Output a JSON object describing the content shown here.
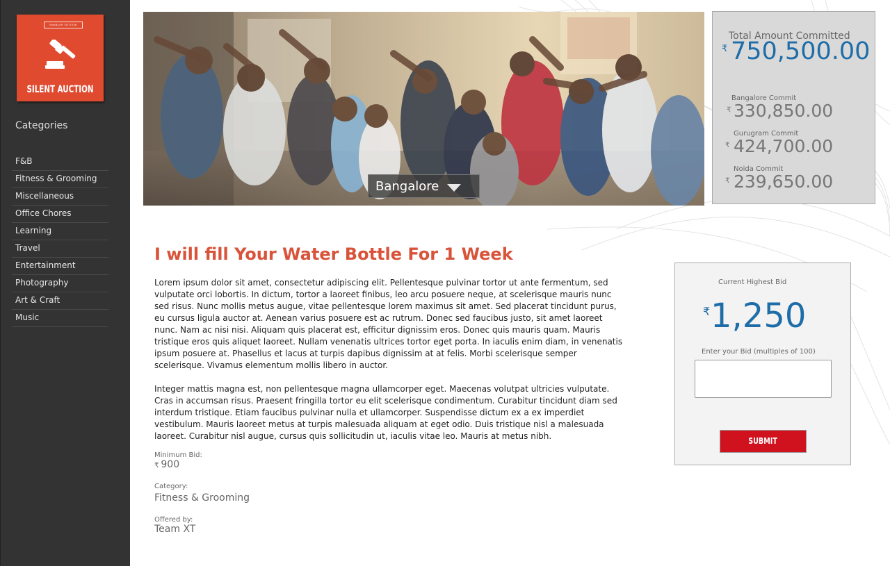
{
  "sidebar": {
    "logo": {
      "badge": "ENABLER EDITION",
      "title": "SILENT AUCTION"
    },
    "categories_title": "Categories",
    "categories": [
      "F&B",
      "Fitness & Grooming",
      "Miscellaneous",
      "Office Chores",
      "Learning",
      "Travel",
      "Entertainment",
      "Photography",
      "Art & Craft",
      "Music"
    ]
  },
  "hero": {
    "city": "Bangalore",
    "arrow_icon": "caret-down-icon"
  },
  "totals": {
    "label": "Total Amount Committed",
    "currency": "₹",
    "value": "750,500.00",
    "cities": [
      {
        "label": "Bangalore Commit",
        "value": "330,850.00"
      },
      {
        "label": "Gurugram Commit",
        "value": "424,700.00"
      },
      {
        "label": "Noida Commit",
        "value": "239,650.00"
      }
    ]
  },
  "item": {
    "title": "I will fill Your Water Bottle For 1 Week",
    "description": [
      "Lorem ipsum dolor sit amet, consectetur adipiscing elit. Pellentesque pulvinar tortor ut ante fermentum, sed vulputate orci lobortis. In dictum, tortor a laoreet finibus, leo arcu posuere neque, at scelerisque mauris nunc sed risus. Nunc mollis metus augue, vitae pellentesque lorem maximus sit amet. Sed placerat tincidunt purus, eu cursus ligula auctor at. Aenean varius posuere est ac rutrum. Donec sed faucibus justo, sit amet laoreet nunc. Nam ac nisi nisi. Aliquam quis placerat est, efficitur dignissim eros. Donec quis mauris quam. Mauris tristique eros quis aliquet laoreet. Nullam venenatis ultrices tortor eget porta. In iaculis enim diam, in venenatis ipsum posuere at. Phasellus et lacus at turpis dapibus dignissim at at felis. Morbi scelerisque semper scelerisque. Vivamus elementum mollis libero in auctor.",
      "Integer mattis magna est, non pellentesque magna ullamcorper eget. Maecenas volutpat ultricies vulputate. Cras in accumsan risus. Praesent fringilla tortor eu elit scelerisque condimentum. Curabitur tincidunt diam sed interdum tristique. Etiam faucibus pulvinar nulla et ullamcorper. Suspendisse dictum ex a ex imperdiet vestibulum. Mauris laoreet metus at turpis malesuada aliquam at eget odio. Duis tristique nisl a malesuada laoreet. Curabitur nisl augue, cursus quis sollicitudin ut, iaculis vitae leo. Mauris at metus nibh."
    ],
    "min_bid_label": "Minimum Bid:",
    "min_bid_value": "900",
    "category_label": "Category:",
    "category_value": "Fitness & Grooming",
    "offered_label": "Offered by:",
    "offered_value": "Team XT"
  },
  "bid": {
    "highest_label": "Current Highest Bid",
    "currency": "₹",
    "highest_value": "1,250",
    "enter_label": "Enter your Bid (multiples of 100)",
    "input_value": "",
    "submit_label": "SUBMIT"
  },
  "colors": {
    "sidebar": "#333333",
    "logo": "#e04a2f",
    "accent_blue": "#1e6da8",
    "title_red": "#d9533a",
    "submit_red": "#d0121f"
  }
}
